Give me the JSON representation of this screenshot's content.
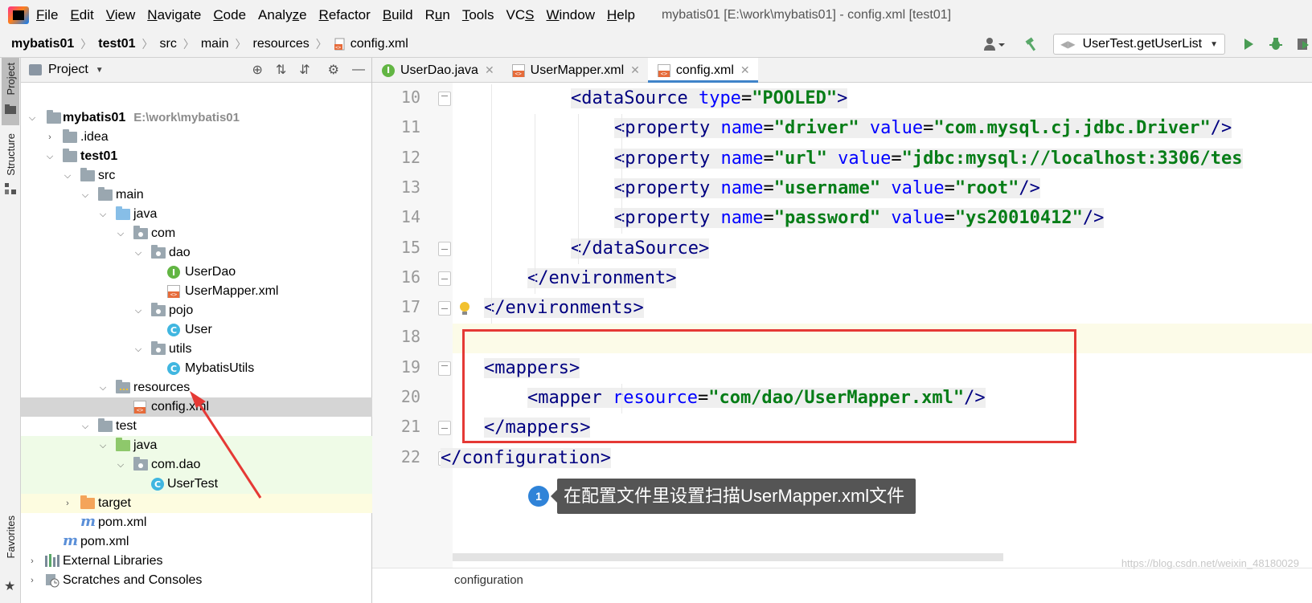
{
  "menubar": {
    "items": [
      "File",
      "Edit",
      "View",
      "Navigate",
      "Code",
      "Analyze",
      "Refactor",
      "Build",
      "Run",
      "Tools",
      "VCS",
      "Window",
      "Help"
    ],
    "mnemonics": [
      "F",
      "E",
      "V",
      "N",
      "C",
      "z",
      "R",
      "B",
      "u",
      "T",
      "S",
      "W",
      "H"
    ],
    "window_title": "mybatis01 [E:\\work\\mybatis01] - config.xml [test01]"
  },
  "navbar": {
    "crumbs": [
      "mybatis01",
      "test01",
      "src",
      "main",
      "resources",
      "config.xml"
    ],
    "run_config": "UserTest.getUserList"
  },
  "stripe": {
    "project": "Project",
    "structure": "Structure",
    "favorites": "Favorites"
  },
  "project_panel": {
    "title": "Project",
    "tree": [
      {
        "label": "mybatis01",
        "path": "E:\\work\\mybatis01"
      },
      {
        "label": ".idea"
      },
      {
        "label": "test01"
      },
      {
        "label": "src"
      },
      {
        "label": "main"
      },
      {
        "label": "java"
      },
      {
        "label": "com"
      },
      {
        "label": "dao"
      },
      {
        "label": "UserDao"
      },
      {
        "label": "UserMapper.xml"
      },
      {
        "label": "pojo"
      },
      {
        "label": "User"
      },
      {
        "label": "utils"
      },
      {
        "label": "MybatisUtils"
      },
      {
        "label": "resources"
      },
      {
        "label": "config.xml"
      },
      {
        "label": "test"
      },
      {
        "label": "java"
      },
      {
        "label": "com.dao"
      },
      {
        "label": "UserTest"
      },
      {
        "label": "target"
      },
      {
        "label": "pom.xml"
      },
      {
        "label": "pom.xml"
      },
      {
        "label": "External Libraries"
      },
      {
        "label": "Scratches and Consoles"
      }
    ]
  },
  "tabs": [
    {
      "label": "UserDao.java",
      "icon": "interface-icon"
    },
    {
      "label": "UserMapper.xml",
      "icon": "xml-file-icon"
    },
    {
      "label": "config.xml",
      "icon": "xml-file-icon",
      "active": true
    }
  ],
  "editor": {
    "line_numbers": [
      "10",
      "11",
      "12",
      "13",
      "14",
      "15",
      "16",
      "17",
      "18",
      "19",
      "20",
      "21",
      "22"
    ],
    "lines": [
      {
        "t1": "<",
        "tag": "dataSource",
        "a1": " type",
        "eq1": "=",
        "v1": "\"POOLED\"",
        "end": ">"
      },
      {
        "t1": "<",
        "tag": "property",
        "a1": " name",
        "eq1": "=",
        "v1": "\"driver\"",
        "a2": " value",
        "eq2": "=",
        "v2": "\"com.mysql.cj.jdbc.Driver\"",
        "end": "/>"
      },
      {
        "t1": "<",
        "tag": "property",
        "a1": " name",
        "eq1": "=",
        "v1": "\"url\"",
        "a2": " value",
        "eq2": "=",
        "v2": "\"jdbc:mysql://localhost:3306/tes",
        "end": ""
      },
      {
        "t1": "<",
        "tag": "property",
        "a1": " name",
        "eq1": "=",
        "v1": "\"username\"",
        "a2": " value",
        "eq2": "=",
        "v2": "\"root\"",
        "end": "/>"
      },
      {
        "t1": "<",
        "tag": "property",
        "a1": " name",
        "eq1": "=",
        "v1": "\"password\"",
        "a2": " value",
        "eq2": "=",
        "v2": "\"ys20010412\"",
        "end": "/>"
      },
      {
        "t1": "</",
        "tag": "dataSource",
        "end": ">"
      },
      {
        "t1": "</",
        "tag": "environment",
        "end": ">"
      },
      {
        "t1": "</",
        "tag": "environments",
        "end": ">"
      },
      {},
      {
        "t1": "<",
        "tag": "mappers",
        "end": ">"
      },
      {
        "t1": "<",
        "tag": "mapper",
        "a1": " resource",
        "eq1": "=",
        "v1": "\"com/dao/UserMapper.xml\"",
        "end": "/>"
      },
      {
        "t1": "</",
        "tag": "mappers",
        "end": ">"
      },
      {
        "t1": "</",
        "tag": "configuration",
        "end": ">"
      }
    ],
    "breadcrumb": "configuration"
  },
  "callout": {
    "number": "1",
    "text": "在配置文件里设置扫描UserMapper.xml文件"
  },
  "watermark": "https://blog.csdn.net/weixin_48180029",
  "colors": {
    "accent": "#4083c9",
    "highlight_box": "#e53935",
    "tag": "#000080",
    "attr_name": "#0000ff",
    "attr_value": "#067d17"
  }
}
